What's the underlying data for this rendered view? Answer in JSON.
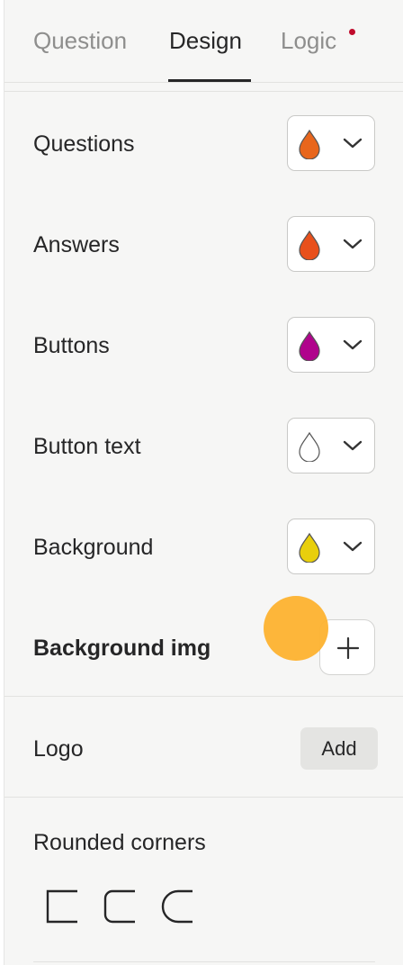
{
  "tabs": [
    {
      "label": "Question",
      "active": false
    },
    {
      "label": "Design",
      "active": true
    },
    {
      "label": "Logic",
      "active": false,
      "has_notification_dot": true
    }
  ],
  "design": {
    "color_rows": [
      {
        "label": "Questions",
        "color": "#e8661c",
        "icon": "droplet-icon"
      },
      {
        "label": "Answers",
        "color": "#e8501c",
        "icon": "droplet-icon"
      },
      {
        "label": "Buttons",
        "color": "#b0048c",
        "icon": "droplet-icon"
      },
      {
        "label": "Button text",
        "color": "#ffffff",
        "icon": "droplet-icon"
      },
      {
        "label": "Background",
        "color": "#e8cf0c",
        "icon": "droplet-icon"
      }
    ],
    "background_img": {
      "label": "Background img",
      "button_icon": "plus-icon"
    },
    "logo": {
      "label": "Logo",
      "button_label": "Add"
    },
    "rounded_corners": {
      "label": "Rounded corners",
      "options": [
        "square-corners-icon",
        "rounded-corners-icon",
        "extra-rounded-corners-icon"
      ]
    }
  },
  "colors": {
    "accent_dot": "#c00b2c",
    "cursor_highlight": "#fdb22f",
    "panel_bg": "#f6f6f5"
  }
}
